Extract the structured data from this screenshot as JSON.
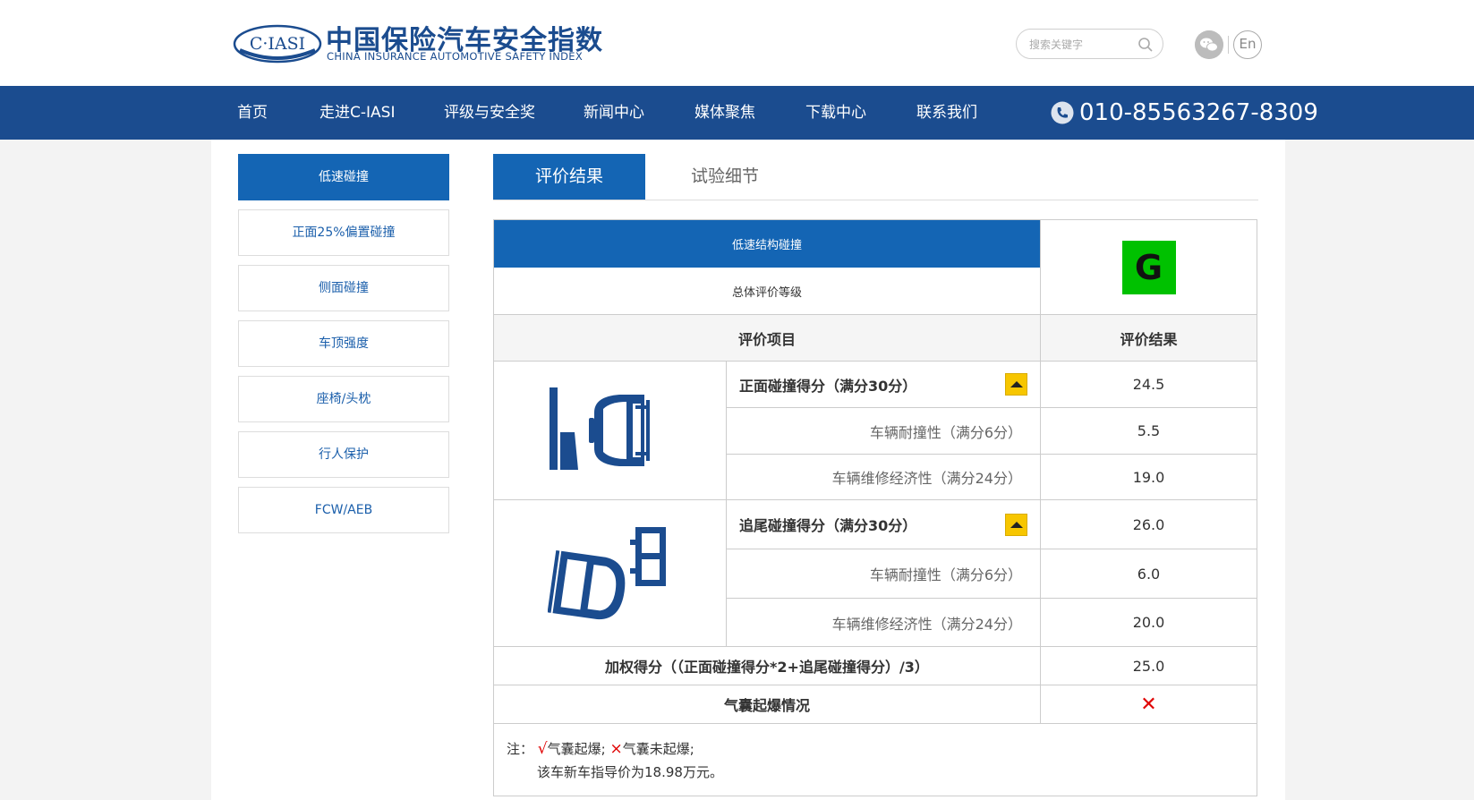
{
  "brand": {
    "logo_mark": "C·IASI",
    "title_cn": "中国保险汽车安全指数",
    "title_en": "CHINA INSURANCE AUTOMOTIVE SAFETY INDEX",
    "color": "#1b4c8f"
  },
  "header": {
    "search_placeholder": "搜索关键字",
    "lang_label": "En"
  },
  "nav": {
    "items": [
      "首页",
      "走进C-IASI",
      "评级与安全奖",
      "新闻中心",
      "媒体聚焦",
      "下载中心",
      "联系我们"
    ],
    "phone": "010-85563267-8309",
    "bg_color": "#1b4c8f"
  },
  "sidebar": {
    "items": [
      "低速碰撞",
      "正面25%偏置碰撞",
      "侧面碰撞",
      "车顶强度",
      "座椅/头枕",
      "行人保护",
      "FCW/AEB"
    ],
    "active_index": 0
  },
  "tabs": {
    "items": [
      "评价结果",
      "试验细节"
    ],
    "active_index": 0
  },
  "result": {
    "test_name": "低速结构碰撞",
    "overall_label": "总体评价等级",
    "overall_grade": "G",
    "grade_color": "#00c100",
    "col_item": "评价项目",
    "col_result": "评价结果",
    "front": {
      "title": "正面碰撞得分（满分30分）",
      "score": "24.5",
      "rows": [
        {
          "label": "车辆耐撞性（满分6分）",
          "value": "5.5"
        },
        {
          "label": "车辆维修经济性（满分24分）",
          "value": "19.0"
        }
      ]
    },
    "rear": {
      "title": "追尾碰撞得分（满分30分）",
      "score": "26.0",
      "rows": [
        {
          "label": "车辆耐撞性（满分6分）",
          "value": "6.0"
        },
        {
          "label": "车辆维修经济性（满分24分）",
          "value": "20.0"
        }
      ]
    },
    "weighted_label": "加权得分（（正面碰撞得分*2+追尾碰撞得分）/3）",
    "weighted_value": "25.0",
    "airbag_label": "气囊起爆情况",
    "airbag_value": "✕",
    "note_prefix": "注：",
    "note_deployed_mark": "√",
    "note_deployed": "气囊起爆;",
    "note_not_deployed_mark": "×",
    "note_not_deployed": "气囊未起爆;",
    "note_price": "该车新车指导价为18.98万元。"
  }
}
